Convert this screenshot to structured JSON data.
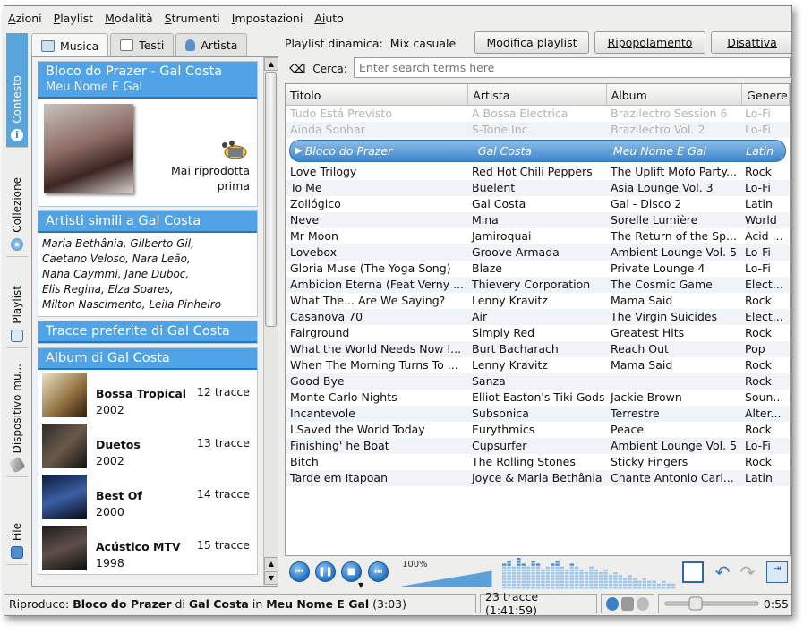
{
  "menu": [
    {
      "u": "A",
      "rest": "zioni"
    },
    {
      "u": "P",
      "rest": "laylist"
    },
    {
      "u": "M",
      "rest": "odalità"
    },
    {
      "u": "S",
      "rest": "trumenti"
    },
    {
      "u": "I",
      "rest": "mpostazioni"
    },
    {
      "u": "Ai",
      "rest": "uto"
    }
  ],
  "menu_plain": [
    "Azioni",
    "Playlist",
    "Modalità",
    "Strumenti",
    "Impostazioni",
    "Aiuto"
  ],
  "sidetabs": {
    "contesto": "Contesto",
    "collezione": "Collezione",
    "playlist": "Playlist",
    "dispositivo": "Dispositivo mu...",
    "file": "File"
  },
  "context_tabs": {
    "musica": "Musica",
    "testi": "Testi",
    "artista": "Artista"
  },
  "context": {
    "now_title": "Bloco do Prazer - Gal Costa",
    "now_album": "Meu Nome E Gal",
    "never_played": "Mai riprodotta",
    "never_played2": "prima",
    "similar_head": "Artisti simili a Gal Costa",
    "similar_lines": [
      "Maria Bethânia, Gilberto Gil,",
      "Caetano Veloso, Nara Leão,",
      "Nana Caymmi, Jane Duboc,",
      "Elis Regina, Elza Soares,",
      "Milton Nascimento, Leila Pinheiro"
    ],
    "fav_head": "Tracce preferite di Gal Costa",
    "albums_head": "Album di Gal Costa",
    "albums": [
      {
        "name": "Bossa Tropical",
        "year": "2002",
        "count": "12 tracce"
      },
      {
        "name": "Duetos",
        "year": "2002",
        "count": "13 tracce"
      },
      {
        "name": "Best Of",
        "year": "2000",
        "count": "14 tracce"
      },
      {
        "name": "Acústico MTV",
        "year": "1998",
        "count": "15 tracce"
      }
    ]
  },
  "playlist_header": {
    "label": "Playlist dinamica:",
    "mode": "Mix casuale",
    "edit_btn": "Modifica playlist",
    "repopulate_btn": "Ripopolamento",
    "disable_btn": "Disattiva"
  },
  "search": {
    "label": "Cerca:",
    "placeholder": "Enter search terms here"
  },
  "columns": [
    "Titolo",
    "Artista",
    "Album",
    "Genere"
  ],
  "played_rows": [
    [
      "Tudo Está Previsto",
      "A Bossa Electrica",
      "Brazilectro Session 6",
      "Lo-Fi"
    ],
    [
      "Ainda Sonhar",
      "S-Tone Inc.",
      "Brazilectro Vol. 2",
      "Lo-Fi"
    ]
  ],
  "current_row": [
    "Bloco do Prazer",
    "Gal Costa",
    "Meu Nome E Gal",
    "Latin"
  ],
  "rows": [
    [
      "Love Trilogy",
      "Red Hot Chili Peppers",
      "The Uplift Mofo Party...",
      "Rock"
    ],
    [
      "To Me",
      "Buelent",
      "Asia Lounge Vol. 3",
      "Lo-Fi"
    ],
    [
      "Zoilógico",
      "Gal Costa",
      "Gal - Disco 2",
      "Latin"
    ],
    [
      "Neve",
      "Mina",
      "Sorelle Lumière",
      "World"
    ],
    [
      "Mr Moon",
      "Jamiroquai",
      "The Return of the Sp...",
      "Acid ..."
    ],
    [
      "Lovebox",
      "Groove Armada",
      "Ambient Lounge Vol. 5",
      "Lo-Fi"
    ],
    [
      "Gloria Muse (The Yoga Song)",
      "Blaze",
      "Private Lounge 4",
      "Lo-Fi"
    ],
    [
      "Ambicion Eterna (Feat Verny ...",
      "Thievery Corporation",
      "The Cosmic Game",
      "Elect..."
    ],
    [
      "What The... Are We Saying?",
      "Lenny Kravitz",
      "Mama Said",
      "Rock"
    ],
    [
      "Casanova 70",
      "Air",
      "The Virgin Suicides",
      "Elect..."
    ],
    [
      "Fairground",
      "Simply Red",
      "Greatest Hits",
      "Rock"
    ],
    [
      "What the World Needs Now I...",
      "Burt Bacharach",
      "Reach Out",
      "Pop"
    ],
    [
      "When The Morning Turns To ...",
      "Lenny Kravitz",
      "Mama Said",
      "Rock"
    ],
    [
      "Good Bye",
      "Sanza",
      "",
      "Rock"
    ],
    [
      "Monte Carlo Nights",
      "Elliot Easton's Tiki Gods",
      "Jackie Brown",
      "Soun..."
    ],
    [
      "Incantevole",
      "Subsonica",
      "Terrestre",
      "Alter..."
    ],
    [
      "I Saved the World Today",
      "Eurythmics",
      "Peace",
      "Rock"
    ],
    [
      "Finishing' he Boat",
      "Cupsurfer",
      "Ambient Lounge Vol. 5",
      "Lo-Fi"
    ],
    [
      "Bitch",
      "The Rolling Stones",
      "Sticky Fingers",
      "Rock"
    ],
    [
      "Tarde em Itapoan",
      "Joyce & Maria Bethânia",
      "Chante Antonio Carl...",
      "Latin"
    ]
  ],
  "volume": {
    "label": "100%",
    "level": 1.0
  },
  "status": {
    "prefix": "Riproduco:",
    "title": "Bloco do Prazer",
    "di": "di",
    "artist": "Gal Costa",
    "in": "in",
    "album": "Meu Nome E Gal",
    "length": "(3:03)",
    "tracks": "23 tracce (1:41:59)",
    "time": "0:55",
    "seek_fraction": 0.3
  },
  "colors": {
    "accent": "#4fa3e6",
    "current_row": "#3c86cc"
  }
}
